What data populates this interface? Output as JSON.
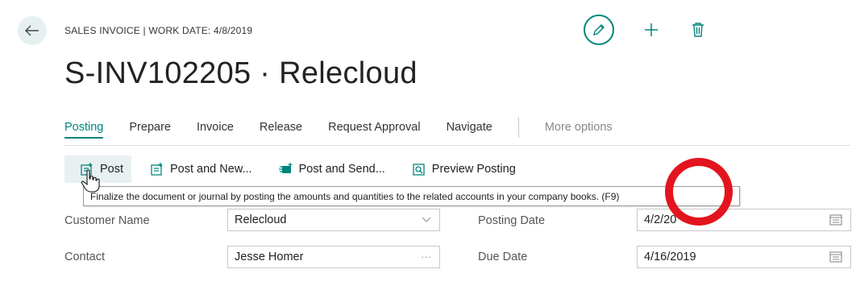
{
  "page": {
    "caption": "SALES INVOICE | WORK DATE: 4/8/2019",
    "title": "S-INV102205 · Relecloud"
  },
  "tabs": [
    {
      "label": "Posting",
      "active": true
    },
    {
      "label": "Prepare"
    },
    {
      "label": "Invoice"
    },
    {
      "label": "Release"
    },
    {
      "label": "Request Approval"
    },
    {
      "label": "Navigate"
    },
    {
      "label": "More options"
    }
  ],
  "actions": [
    {
      "label": "Post",
      "icon": "post-icon"
    },
    {
      "label": "Post and New...",
      "icon": "post-new-icon"
    },
    {
      "label": "Post and Send...",
      "icon": "post-send-icon"
    },
    {
      "label": "Preview Posting",
      "icon": "preview-posting-icon"
    }
  ],
  "tooltip": "Finalize the document or journal by posting the amounts and quantities to the related accounts in your company books. (F9)",
  "form": {
    "customer_name_label": "Customer Name",
    "customer_name_value": "Relecloud",
    "contact_label": "Contact",
    "contact_value": "Jesse Homer",
    "contact_more": "···",
    "posting_date_label": "Posting Date",
    "posting_date_value": "4/2/20",
    "due_date_label": "Due Date",
    "due_date_value": "4/16/2019"
  },
  "colors": {
    "accent": "#00857d",
    "highlight_ring": "#e3141e"
  }
}
